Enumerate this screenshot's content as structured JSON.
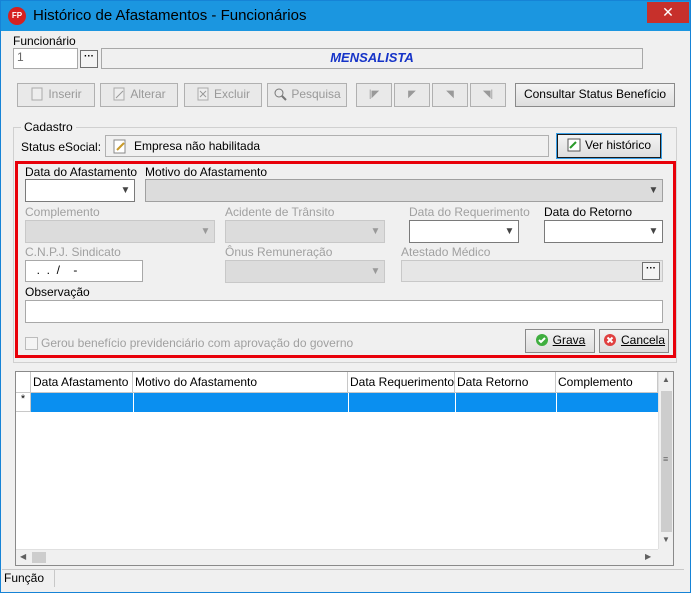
{
  "window": {
    "title": "Histórico de Afastamentos - Funcionários",
    "close": "✕",
    "app_icon": "FP"
  },
  "funcionario": {
    "label": "Funcionário",
    "value": "1",
    "type": "MENSALISTA"
  },
  "toolbar": {
    "inserir": "Inserir",
    "alterar": "Alterar",
    "excluir": "Excluir",
    "pesquisa": "Pesquisa",
    "nav": [
      "|◤",
      "◤",
      "◥",
      "◥|"
    ],
    "consultar": "Consultar Status Benefício"
  },
  "cadastro": {
    "legend": "Cadastro",
    "status_label": "Status eSocial:",
    "status_value": "Empresa não habilitada",
    "ver_historico": "Ver histórico"
  },
  "form": {
    "data_afastamento": "Data do Afastamento",
    "motivo": "Motivo do Afastamento",
    "complemento": "Complemento",
    "acidente": "Acidente de Trânsito",
    "data_requerimento": "Data do Requerimento",
    "data_retorno": "Data do Retorno",
    "cnpj": "C.N.P.J. Sindicato",
    "cnpj_value": "  .  .  /    -",
    "onus": "Ônus Remuneração",
    "atestado": "Atestado Médico",
    "observacao": "Observação",
    "gerou": "Gerou benefício previdenciário com aprovação do governo",
    "grava": "Grava",
    "cancela": "Cancela"
  },
  "grid": {
    "columns": [
      "Data Afastamento",
      "Motivo do Afastamento",
      "Data Requerimento",
      "Data Retorno",
      "Complemento"
    ],
    "row_marker": "*"
  },
  "statusbar": {
    "text": "Função"
  },
  "colors": {
    "titlebar": "#1b96e0",
    "highlight": "#e8000a",
    "selection": "#0a8ff0"
  }
}
